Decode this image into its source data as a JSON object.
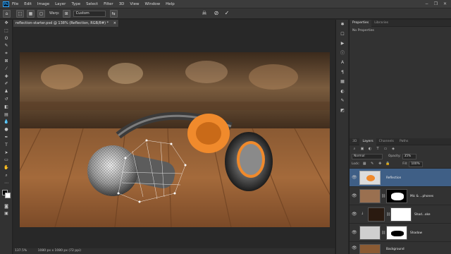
{
  "app": {
    "logo": "Ps"
  },
  "menu": [
    "File",
    "Edit",
    "Image",
    "Layer",
    "Type",
    "Select",
    "Filter",
    "3D",
    "View",
    "Window",
    "Help"
  ],
  "window_controls": {
    "minimize": "−",
    "restore": "❐",
    "close": "✕"
  },
  "options_bar": {
    "warp_label": "Warp:",
    "warp_value": "Custom",
    "cancel_glyph": "⊘",
    "commit_glyph": "✓"
  },
  "document": {
    "tab_title": "reflection-starter.psd @ 138% (Reflection, RGB/8#) *",
    "tab_close": "×"
  },
  "status": {
    "zoom": "137.5%",
    "doc_size": "1080 px x 1080 px (72 ppi)"
  },
  "panels": {
    "top_tabs": [
      "Properties",
      "Libraries"
    ],
    "properties_text": "No Properties",
    "bottom_tabs": [
      "3D",
      "Layers",
      "Channels",
      "Paths"
    ],
    "blend_mode": "Normal",
    "opacity_label": "Opacity:",
    "opacity_value": "35%",
    "lock_label": "Lock:",
    "fill_label": "Fill:",
    "fill_value": "100%"
  },
  "layers": [
    {
      "name": "Reflection",
      "selected": true
    },
    {
      "name": "Mic & ...phones",
      "selected": false
    },
    {
      "name": "Shad...oke",
      "selected": false
    },
    {
      "name": "Shadow",
      "selected": false
    },
    {
      "name": "Background",
      "selected": false
    }
  ],
  "colors": {
    "accent_selected": "#3f5f86",
    "earcup_orange": "#f08a2c"
  }
}
